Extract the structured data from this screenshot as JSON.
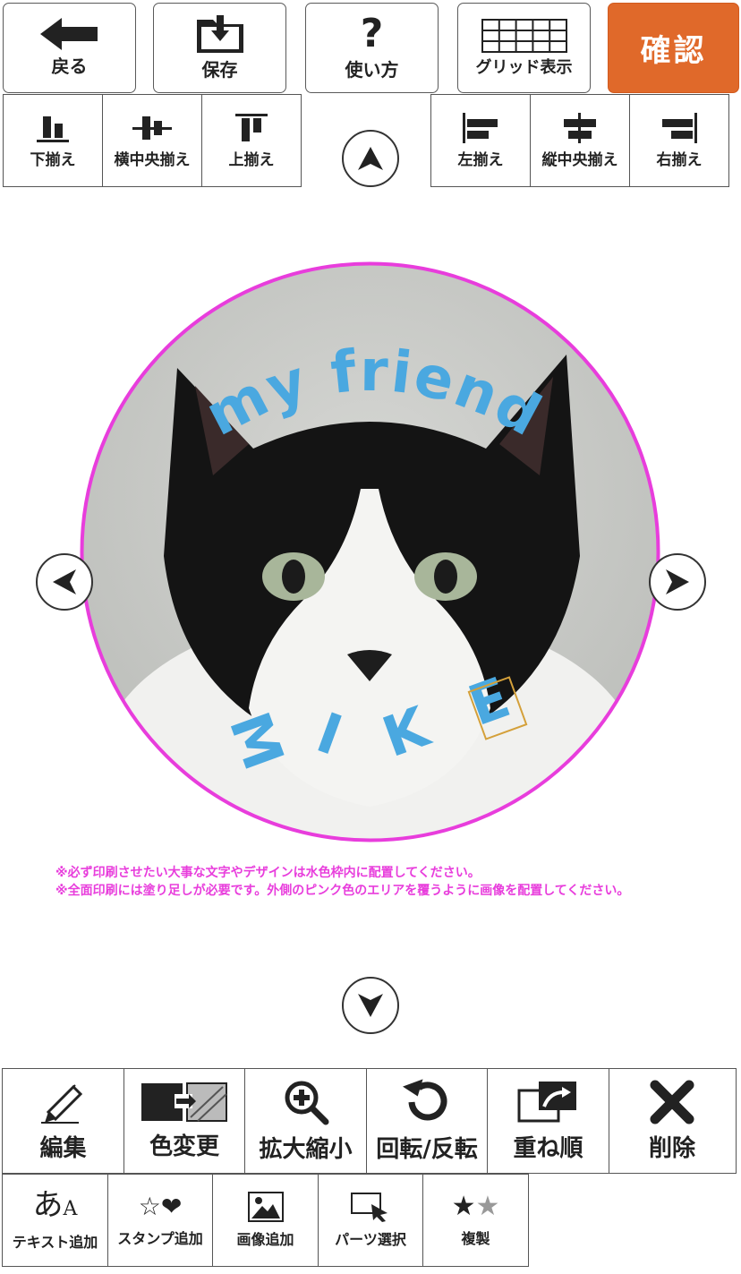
{
  "toolbar": {
    "back_label": "戻る",
    "save_label": "保存",
    "help_label": "使い方",
    "grid_label": "グリッド表示",
    "confirm_label": "確認"
  },
  "align": {
    "bottom": "下揃え",
    "h_center": "横中央揃え",
    "top": "上揃え",
    "left": "左揃え",
    "v_center": "縦中央揃え",
    "right": "右揃え"
  },
  "canvas": {
    "arc_text_top": "my friend",
    "arc_text_bottom": "MIKE",
    "guide_color": "#e83ddc",
    "text_color": "#4aa8e0"
  },
  "notes": {
    "line1": "※必ず印刷させたい大事な文字やデザインは水色枠内に配置してください。",
    "line2": "※全面印刷には塗り足しが必要です。外側のピンク色のエリアを覆うように画像を配置してください。"
  },
  "tools": {
    "edit": "編集",
    "color_change": "色変更",
    "zoom": "拡大縮小",
    "rotate_flip": "回転/反転",
    "layer_order": "重ね順",
    "delete": "削除"
  },
  "add": {
    "text": "テキスト追加",
    "stamp": "スタンプ追加",
    "image": "画像追加",
    "parts_select": "パーツ選択",
    "duplicate": "複製"
  },
  "colors": {
    "confirm_bg": "#e0692a",
    "guide_pink": "#e83ddc",
    "text_blue": "#4aa8e0"
  }
}
